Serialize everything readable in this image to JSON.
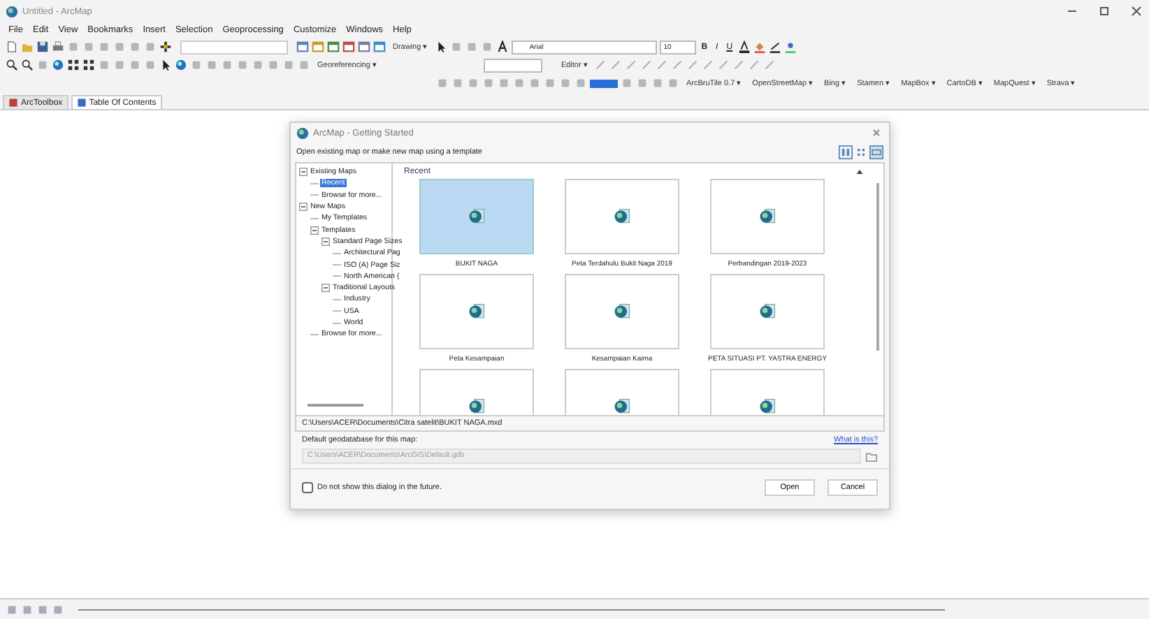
{
  "window": {
    "title": "Untitled - ArcMap"
  },
  "menu": [
    "File",
    "Edit",
    "View",
    "Bookmarks",
    "Insert",
    "Selection",
    "Geoprocessing",
    "Customize",
    "Windows",
    "Help"
  ],
  "toolbar_dropdowns": [
    [
      "Drawing ▾"
    ],
    [
      "Georeferencing ▾",
      "Editor ▾"
    ],
    [
      "ArcBruTile 0.7 ▾",
      "OpenStreetMap ▾",
      "Bing ▾",
      "Stamen ▾",
      "MapBox ▾",
      "CartoDB ▾",
      "MapQuest ▾",
      "Strava ▾"
    ]
  ],
  "font_field": {
    "value": "Arial"
  },
  "size_field": {
    "value": "10"
  },
  "format_buttons": [
    "B",
    "I",
    "U"
  ],
  "panel_tabs": [
    {
      "label": "ArcToolbox",
      "selected": false
    },
    {
      "label": "Table Of Contents",
      "selected": true
    }
  ],
  "dialog": {
    "title": "ArcMap - Getting Started",
    "subtitle": "Open existing map or make new map using a template",
    "tree": [
      {
        "label": "Existing Maps",
        "expanded": true,
        "selected": false,
        "children": [
          {
            "label": "Recent",
            "selected": true
          },
          {
            "label": "Browse for more...",
            "selected": false
          }
        ]
      },
      {
        "label": "New Maps",
        "expanded": true,
        "selected": false,
        "children": [
          {
            "label": "My Templates",
            "selected": false
          },
          {
            "label": "Templates",
            "expanded": true,
            "selected": false,
            "children": [
              {
                "label": "Standard Page Sizes",
                "expanded": true,
                "selected": false,
                "children": [
                  {
                    "label": "Architectural Pag",
                    "selected": false
                  },
                  {
                    "label": "ISO (A) Page Siz",
                    "selected": false
                  },
                  {
                    "label": "North American (",
                    "selected": false
                  }
                ]
              },
              {
                "label": "Traditional Layouts",
                "expanded": true,
                "selected": false,
                "children": [
                  {
                    "label": "Industry",
                    "selected": false
                  },
                  {
                    "label": "USA",
                    "selected": false
                  },
                  {
                    "label": "World",
                    "selected": false
                  }
                ]
              }
            ]
          },
          {
            "label": "Browse for more...",
            "selected": false
          }
        ]
      }
    ],
    "section": "Recent",
    "maps": [
      {
        "label": "BUKIT NAGA",
        "selected": true
      },
      {
        "label": "Peta Terdahulu Bukit Naga 2019",
        "selected": false
      },
      {
        "label": "Perbandingan 2019-2023",
        "selected": false
      },
      {
        "label": "Peta Kesampaian",
        "selected": false
      },
      {
        "label": "Kesampaian Kaima",
        "selected": false
      },
      {
        "label": "PETA SITUASI PT. YASTRA ENERGY",
        "selected": false
      },
      {
        "selected": false
      },
      {
        "selected": false
      },
      {
        "selected": false
      }
    ],
    "path": "C:\\Users\\ACER\\Documents\\Citra satelit\\BUKIT NAGA.mxd",
    "geodb_label": "Default geodatabase for this map:",
    "help_link": "What is this?",
    "geodb_path": "C:\\Users\\ACER\\Documents\\ArcGIS\\Default.gdb",
    "dont_show": {
      "label": "Do not show this dialog in the future.",
      "checked": false
    },
    "buttons": [
      "Open",
      "Cancel"
    ]
  }
}
